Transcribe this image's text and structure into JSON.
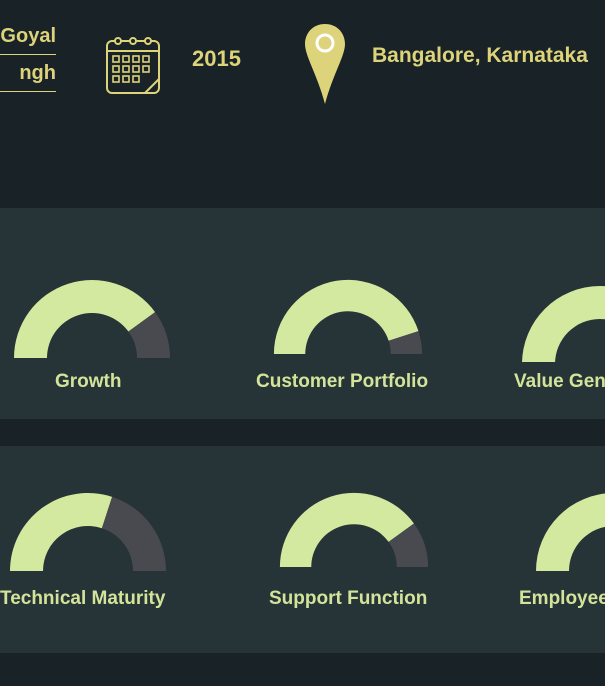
{
  "header": {
    "founders": [
      "Goyal",
      "ngh"
    ],
    "calendar_icon": "calendar-icon",
    "year": "2015",
    "location_icon": "map-pin-icon",
    "location": "Bangalore, Karnataka"
  },
  "colors": {
    "background": "#192226",
    "band": "#263337",
    "accent": "#dcd37a",
    "gauge_fill": "#d3e9a0",
    "gauge_rest": "#494a4f",
    "label": "#d3e49a"
  },
  "rows": [
    {
      "gauges": [
        {
          "label": "Growth",
          "fraction": 0.8
        },
        {
          "label": "Customer Portfolio",
          "fraction": 0.9
        },
        {
          "label": "Value Gen",
          "fraction": 1.0
        }
      ]
    },
    {
      "gauges": [
        {
          "label": "Technical Maturity",
          "fraction": 0.6
        },
        {
          "label": "Support Function",
          "fraction": 0.8
        },
        {
          "label": "Employee",
          "fraction": 1.0
        }
      ]
    }
  ]
}
